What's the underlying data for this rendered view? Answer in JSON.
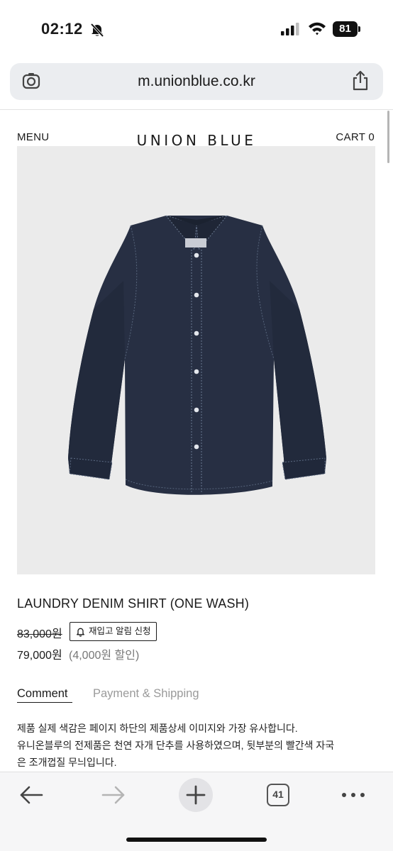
{
  "status": {
    "time": "02:12",
    "battery": "81"
  },
  "browser": {
    "url": "m.unionblue.co.kr",
    "tab_count": "41"
  },
  "header": {
    "menu": "MENU",
    "brand": "UNION BLUE",
    "cart": "CART 0"
  },
  "product": {
    "title": "LAUNDRY DENIM SHIRT (ONE WASH)",
    "original_price": "83,000원",
    "restock_button": "재입고 알림 신청",
    "sale_price": "79,000원",
    "discount": "(4,000원 할인)"
  },
  "tabs": {
    "comment": "Comment",
    "payment": "Payment & Shipping"
  },
  "comment": {
    "line1": "제품 실제 색감은 페이지 하단의 제품상세 이미지와 가장 유사합니다.",
    "line2": "유니온블루의 전제품은 천연 자개 단추를 사용하였으며, 뒷부분의 빨간색 자국",
    "line3": "은 조개껍질 무늬입니다."
  },
  "colors": {
    "denim": "#262f42",
    "image_bg": "#ebebeb",
    "url_bar": "#ebedf0"
  },
  "icons": [
    "bell-slash-icon",
    "signal-icon",
    "wifi-icon",
    "battery-icon",
    "lens-icon",
    "share-icon",
    "bell-icon",
    "back-arrow-icon",
    "forward-arrow-icon",
    "plus-icon",
    "more-icon"
  ]
}
